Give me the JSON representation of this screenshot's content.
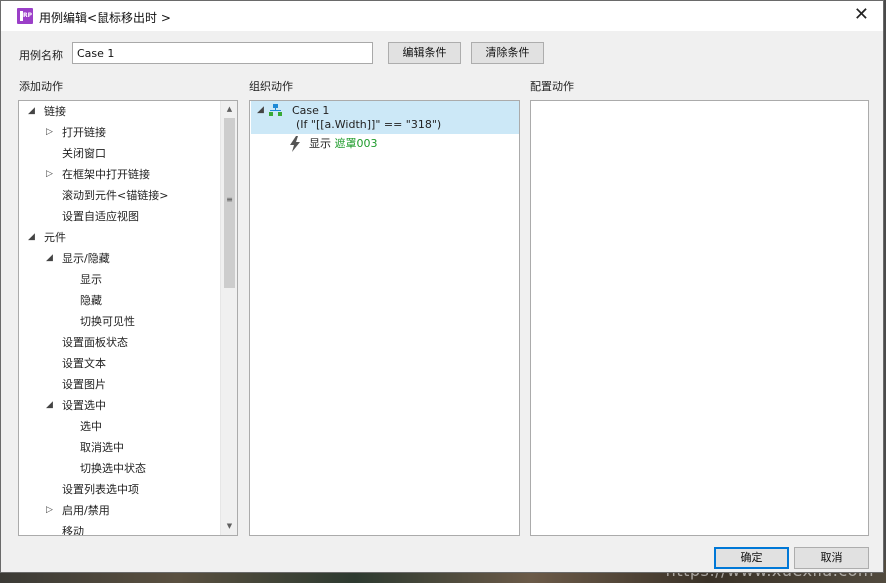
{
  "window": {
    "title": "用例编辑<鼠标移出时 >",
    "app_icon": "axure-rp-icon",
    "close_icon": "close-icon"
  },
  "case_name": {
    "label": "用例名称",
    "value": "Case 1"
  },
  "toolbar": {
    "edit_condition": "编辑条件",
    "clear_condition": "清除条件"
  },
  "sections": {
    "add_action": "添加动作",
    "organize_action": "组织动作",
    "configure_action": "配置动作"
  },
  "action_tree": [
    {
      "label": "链接",
      "expander": "expanded"
    },
    {
      "label": "打开链接",
      "expander": "collapsed"
    },
    {
      "label": "关闭窗口",
      "expander": ""
    },
    {
      "label": "在框架中打开链接",
      "expander": "collapsed"
    },
    {
      "label": "滚动到元件<锚链接>",
      "expander": ""
    },
    {
      "label": "设置自适应视图",
      "expander": ""
    },
    {
      "label": "元件",
      "expander": "expanded"
    },
    {
      "label": "显示/隐藏",
      "expander": "expanded"
    },
    {
      "label": "显示",
      "expander": ""
    },
    {
      "label": "隐藏",
      "expander": ""
    },
    {
      "label": "切换可见性",
      "expander": ""
    },
    {
      "label": "设置面板状态",
      "expander": ""
    },
    {
      "label": "设置文本",
      "expander": ""
    },
    {
      "label": "设置图片",
      "expander": ""
    },
    {
      "label": "设置选中",
      "expander": "expanded"
    },
    {
      "label": "选中",
      "expander": ""
    },
    {
      "label": "取消选中",
      "expander": ""
    },
    {
      "label": "切换选中状态",
      "expander": ""
    },
    {
      "label": "设置列表选中项",
      "expander": ""
    },
    {
      "label": "启用/禁用",
      "expander": "collapsed"
    },
    {
      "label": "移动",
      "expander": ""
    }
  ],
  "organized": {
    "case_title": "Case 1",
    "case_condition": "(If \"[[a.Width]]\" == \"318\")",
    "action_verb": "显示",
    "action_target": "遮罩003",
    "case_icon": "case-tree-icon",
    "action_icon": "lightning-icon"
  },
  "dialog_buttons": {
    "ok": "确定",
    "cancel": "取消"
  },
  "watermark": "https://www.xuexila.com",
  "colors": {
    "selection": "#cce8f7",
    "target_green": "#1e9b2b",
    "app_icon": "#9b3fc8",
    "primary_border": "#0078d7"
  }
}
